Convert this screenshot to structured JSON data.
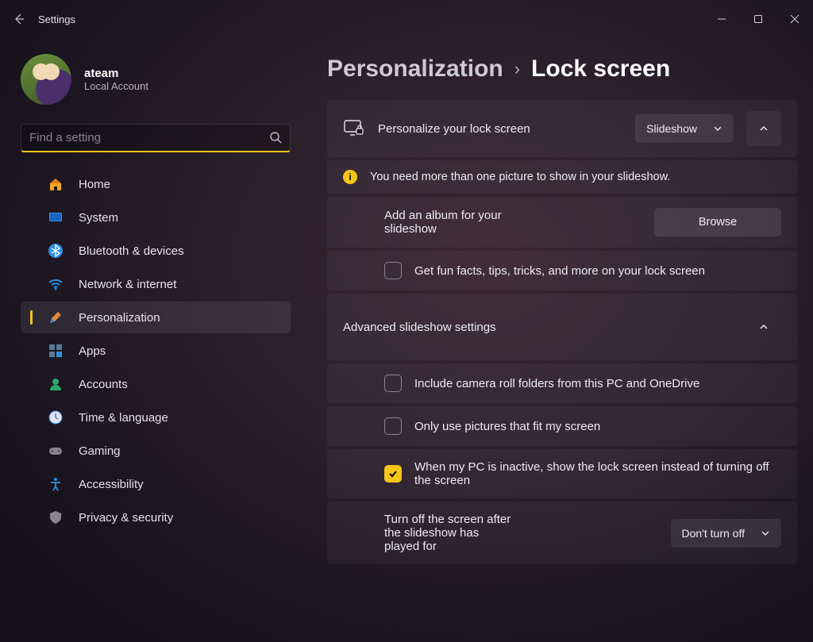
{
  "titlebar": {
    "title": "Settings"
  },
  "profile": {
    "name": "ateam",
    "sub": "Local Account"
  },
  "search": {
    "placeholder": "Find a setting"
  },
  "nav": {
    "items": [
      {
        "label": "Home"
      },
      {
        "label": "System"
      },
      {
        "label": "Bluetooth & devices"
      },
      {
        "label": "Network & internet"
      },
      {
        "label": "Personalization"
      },
      {
        "label": "Apps"
      },
      {
        "label": "Accounts"
      },
      {
        "label": "Time & language"
      },
      {
        "label": "Gaming"
      },
      {
        "label": "Accessibility"
      },
      {
        "label": "Privacy & security"
      }
    ]
  },
  "crumbs": {
    "parent": "Personalization",
    "current": "Lock screen"
  },
  "lockscreen": {
    "personalize_label": "Personalize your lock screen",
    "personalize_value": "Slideshow",
    "warning": "You need more than one picture to show in your slideshow.",
    "add_album_label": "Add an album for your slideshow",
    "browse_label": "Browse",
    "funfacts_label": "Get fun facts, tips, tricks, and more on your lock screen",
    "advanced_header": "Advanced slideshow settings",
    "camera_roll_label": "Include camera roll folders from this PC and OneDrive",
    "fit_label": "Only use pictures that fit my screen",
    "inactive_label": "When my PC is inactive, show the lock screen instead of turning off the screen",
    "turnoff_label": "Turn off the screen after the slideshow has played for",
    "turnoff_value": "Don't turn off"
  }
}
